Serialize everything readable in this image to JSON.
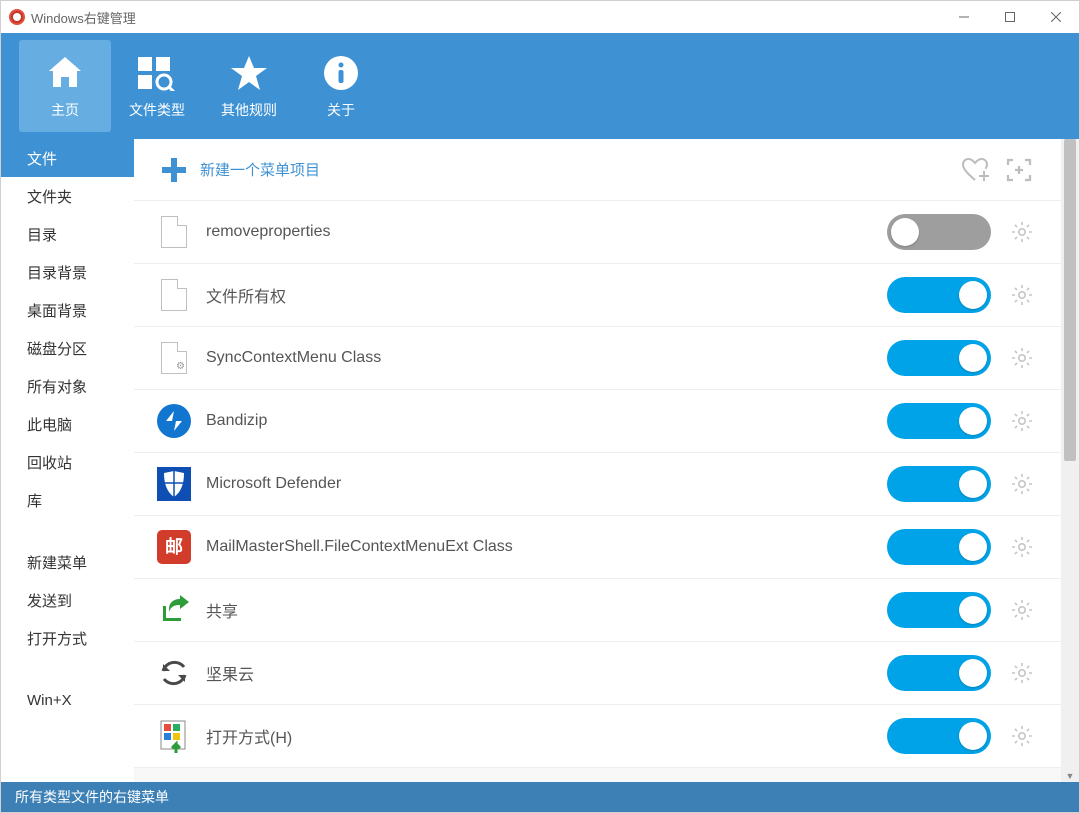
{
  "window": {
    "title": "Windows右键管理"
  },
  "toolbar": {
    "items": [
      {
        "label": "主页"
      },
      {
        "label": "文件类型"
      },
      {
        "label": "其他规则"
      },
      {
        "label": "关于"
      }
    ]
  },
  "sidebar": {
    "groups": [
      [
        "文件",
        "文件夹",
        "目录",
        "目录背景",
        "桌面背景",
        "磁盘分区",
        "所有对象",
        "此电脑",
        "回收站",
        "库"
      ],
      [
        "新建菜单",
        "发送到",
        "打开方式"
      ],
      [
        "Win+X"
      ]
    ],
    "active": "文件"
  },
  "newItem": {
    "label": "新建一个菜单项目"
  },
  "items": [
    {
      "label": "removeproperties",
      "enabled": false,
      "icon": "file"
    },
    {
      "label": "文件所有权",
      "enabled": true,
      "icon": "file"
    },
    {
      "label": "SyncContextMenu Class",
      "enabled": true,
      "icon": "file-gear"
    },
    {
      "label": "Bandizip",
      "enabled": true,
      "icon": "bandizip"
    },
    {
      "label": "Microsoft Defender",
      "enabled": true,
      "icon": "defender"
    },
    {
      "label": "MailMasterShell.FileContextMenuExt Class",
      "enabled": true,
      "icon": "mail"
    },
    {
      "label": "共享",
      "enabled": true,
      "icon": "share"
    },
    {
      "label": "坚果云",
      "enabled": true,
      "icon": "sync"
    },
    {
      "label": "打开方式(H)",
      "enabled": true,
      "icon": "openwith"
    }
  ],
  "status": {
    "text": "所有类型文件的右键菜单"
  }
}
